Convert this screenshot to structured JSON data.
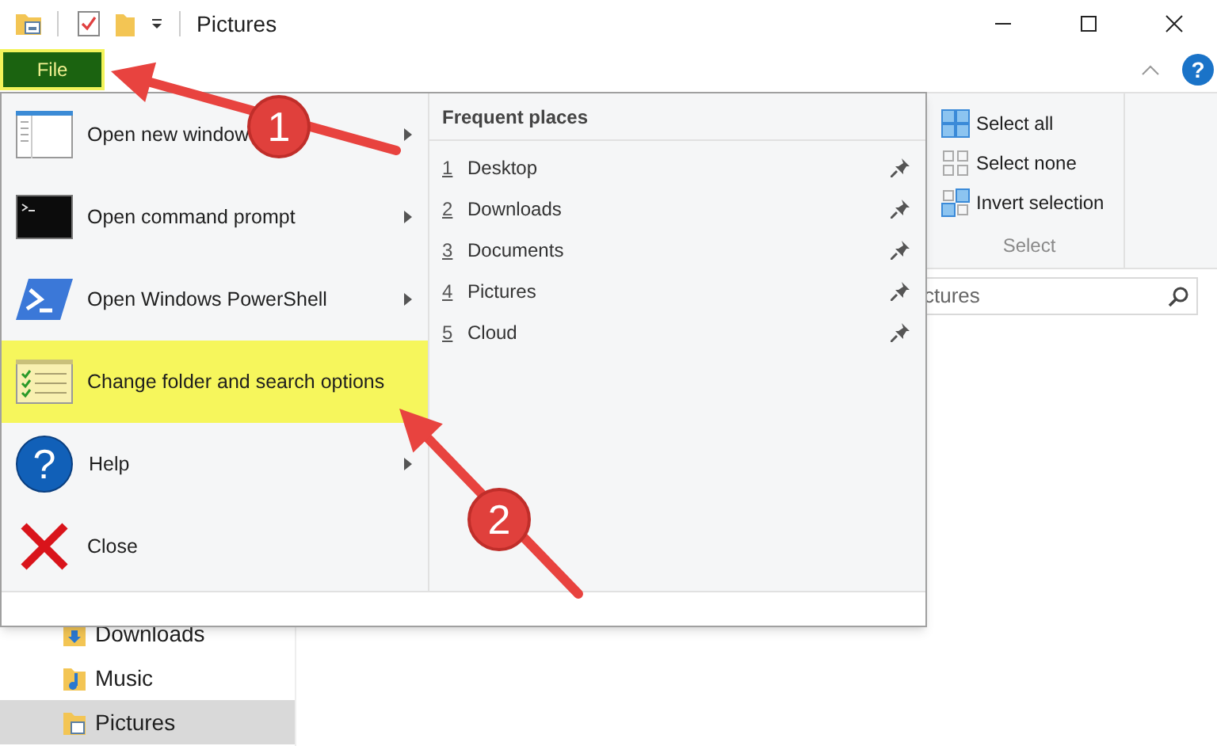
{
  "window": {
    "title": "Pictures"
  },
  "file_tab": {
    "label": "File",
    "highlighted": true
  },
  "help_button": {
    "glyph": "?"
  },
  "ribbon": {
    "select_group": {
      "label": "Select",
      "buttons": [
        {
          "label": "Select all",
          "kind": "all"
        },
        {
          "label": "Select none",
          "kind": "none"
        },
        {
          "label": "Invert selection",
          "kind": "invert"
        }
      ]
    }
  },
  "search": {
    "value": "ctures"
  },
  "navigation": {
    "items": [
      {
        "label": "Downloads",
        "kind": "downloads",
        "selected": false
      },
      {
        "label": "Music",
        "kind": "music",
        "selected": false
      },
      {
        "label": "Pictures",
        "kind": "pictures",
        "selected": true
      }
    ]
  },
  "file_menu": {
    "items": [
      {
        "label": "Open new window",
        "kind": "window",
        "submenu": true,
        "highlighted": false
      },
      {
        "label": "Open command prompt",
        "kind": "prompt",
        "submenu": true,
        "highlighted": false
      },
      {
        "label": "Open Windows PowerShell",
        "kind": "powershell",
        "submenu": true,
        "highlighted": false
      },
      {
        "label": "Change folder and search options",
        "kind": "options",
        "submenu": false,
        "highlighted": true
      },
      {
        "label": "Help",
        "kind": "help",
        "glyph": "?",
        "submenu": true,
        "highlighted": false
      },
      {
        "label": "Close",
        "kind": "close",
        "submenu": false,
        "highlighted": false
      }
    ],
    "frequent_places": {
      "title": "Frequent places",
      "items": [
        {
          "number": "1",
          "label": "Desktop",
          "pinned": true
        },
        {
          "number": "2",
          "label": "Downloads",
          "pinned": true
        },
        {
          "number": "3",
          "label": "Documents",
          "pinned": true
        },
        {
          "number": "4",
          "label": "Pictures",
          "pinned": true
        },
        {
          "number": "5",
          "label": "Cloud",
          "pinned": true
        }
      ]
    }
  },
  "annotations": [
    {
      "label": "1"
    },
    {
      "label": "2"
    }
  ]
}
